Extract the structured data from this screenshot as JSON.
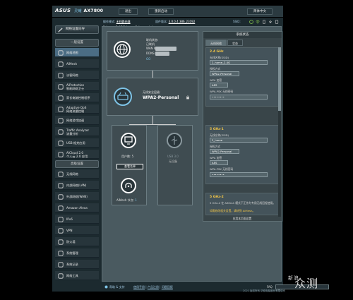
{
  "header": {
    "brand": "ASUS",
    "subtitle": "灵耀",
    "model": "AX7800",
    "logout": "退出",
    "reboot": "重新启动",
    "language": "简体中文"
  },
  "status": {
    "mode_label": "操作模式:",
    "mode_value": "无线路由器",
    "firmware_label": "固件版本:",
    "firmware_value": "3.0.0.4.386_23192",
    "ssid_label": "SSID:",
    "ssid_value": "2_home_2.4G 2_home 2_home_dwb"
  },
  "sidebar": {
    "quick_setup": "网络设置向导",
    "general_header": "一般设置",
    "general": [
      {
        "label": "网络地图",
        "active": true
      },
      {
        "label": "AiMesh"
      },
      {
        "label": "访客网络"
      },
      {
        "label": "AiProtection",
        "sub": "智能网络卫士"
      },
      {
        "label": "家长电脑控制程序"
      },
      {
        "label": "Adaptive QoS",
        "sub": "网络流量控制"
      },
      {
        "label": "网络游戏加速"
      },
      {
        "label": "Traffic Analyzer",
        "sub": "流量分析"
      },
      {
        "label": "USB 相关应用"
      },
      {
        "label": "AiCloud 2.0",
        "sub": "个人云 2.0 应用"
      }
    ],
    "advanced_header": "高级设置",
    "advanced": [
      {
        "label": "无线网络"
      },
      {
        "label": "内部网络(LAN)"
      },
      {
        "label": "外部网络(WAN)"
      },
      {
        "label": "Amazon Alexa"
      },
      {
        "label": "IPv6"
      },
      {
        "label": "VPN"
      },
      {
        "label": "防火墙"
      },
      {
        "label": "系统管理"
      },
      {
        "label": "系统记录"
      },
      {
        "label": "网络工具"
      }
    ]
  },
  "map": {
    "internet_status_label": "联机状态:",
    "internet_status": "已联机",
    "wan_ip_label": "WAN IP:",
    "ddns_label": "DDNS:",
    "ddns_link": "GO",
    "security_label": "无线安全层级:",
    "security_value": "WPA2-Personal",
    "clients_label": "用户数:",
    "clients_value": "5",
    "clients_button": "查看名单",
    "usb_label": "无设备",
    "usb_title": "USB 3.0",
    "aimesh_label": "AiMesh 节点:",
    "aimesh_value": "1"
  },
  "panel": {
    "title": "系统状态",
    "tabs": [
      "无线网络",
      "状态"
    ],
    "bands": [
      {
        "name": "2.4 GHz",
        "ssid_label": "无线名称(SSID)",
        "ssid": "2_home_2.4G",
        "auth_label": "授权方式",
        "auth": "WPA2-Personal",
        "enc_label": "WPA 加密",
        "enc": "AES",
        "key_label": "WPA-PSK 无线密码",
        "key": "••••••••"
      },
      {
        "name": "5 GHz-1",
        "ssid_label": "无线名称(SSID)",
        "ssid": "2_home",
        "auth_label": "授权方式",
        "auth": "WPA2-Personal",
        "enc_label": "WPA 加密",
        "enc": "AES",
        "key_label": "WPA-PSK 无线密码",
        "key": "••••••••"
      },
      {
        "name": "5 GHz-2",
        "note": "5 GHz-2 在 AiMesh 模式下正作为专用无线回程使用。",
        "note2": "如需修改相关设置，请转到 AiMesh。"
      }
    ],
    "apply_button": "应用本页面设置"
  },
  "footer": {
    "help": "帮助 & 支持",
    "manual": "使用手册",
    "utility": "产品注册",
    "feedback": "问题回报",
    "faq": "FAQ"
  },
  "copyright": "2021 版权所有 华硕电脑股份有限公司",
  "watermark": {
    "small": "新浪",
    "big": "众测"
  }
}
